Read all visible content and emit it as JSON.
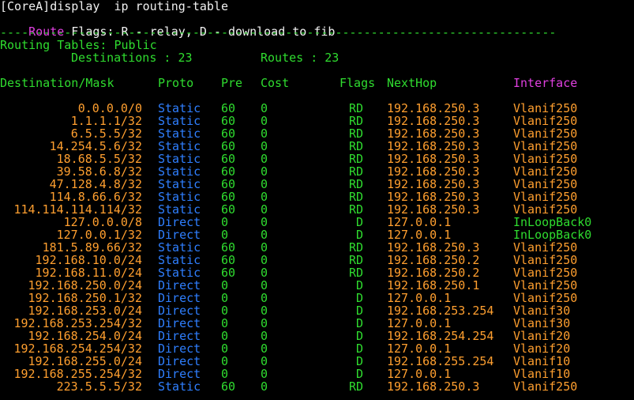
{
  "terminal": {
    "prompt_line": "[CoreA]display  ip routing-table",
    "flags_line": {
      "label": "Route",
      "text": " Flags: R - relay, D - download to fib"
    },
    "separator": "------------------------------------------------------------------------------",
    "tables_line": "Routing Tables: Public",
    "destinations_label": "Destinations : 23",
    "routes_label": "Routes : 23",
    "headers": {
      "destination": "Destination/Mask",
      "proto": "Proto",
      "pre": "Pre",
      "cost": "Cost",
      "flags": "Flags",
      "nexthop": "NextHop",
      "interface": "Interface"
    },
    "routes": [
      {
        "dest": "0.0.0.0/0",
        "proto": "Static",
        "pre": "60",
        "cost": "0",
        "flags": "RD",
        "nexthop": "192.168.250.3",
        "iface": "Vlanif250"
      },
      {
        "dest": "1.1.1.1/32",
        "proto": "Static",
        "pre": "60",
        "cost": "0",
        "flags": "RD",
        "nexthop": "192.168.250.3",
        "iface": "Vlanif250"
      },
      {
        "dest": "6.5.5.5/32",
        "proto": "Static",
        "pre": "60",
        "cost": "0",
        "flags": "RD",
        "nexthop": "192.168.250.3",
        "iface": "Vlanif250"
      },
      {
        "dest": "14.254.5.6/32",
        "proto": "Static",
        "pre": "60",
        "cost": "0",
        "flags": "RD",
        "nexthop": "192.168.250.3",
        "iface": "Vlanif250"
      },
      {
        "dest": "18.68.5.5/32",
        "proto": "Static",
        "pre": "60",
        "cost": "0",
        "flags": "RD",
        "nexthop": "192.168.250.3",
        "iface": "Vlanif250"
      },
      {
        "dest": "39.58.6.8/32",
        "proto": "Static",
        "pre": "60",
        "cost": "0",
        "flags": "RD",
        "nexthop": "192.168.250.3",
        "iface": "Vlanif250"
      },
      {
        "dest": "47.128.4.8/32",
        "proto": "Static",
        "pre": "60",
        "cost": "0",
        "flags": "RD",
        "nexthop": "192.168.250.3",
        "iface": "Vlanif250"
      },
      {
        "dest": "114.8.66.6/32",
        "proto": "Static",
        "pre": "60",
        "cost": "0",
        "flags": "RD",
        "nexthop": "192.168.250.3",
        "iface": "Vlanif250"
      },
      {
        "dest": "114.114.114.114/32",
        "proto": "Static",
        "pre": "60",
        "cost": "0",
        "flags": "RD",
        "nexthop": "192.168.250.3",
        "iface": "Vlanif250"
      },
      {
        "dest": "127.0.0.0/8",
        "proto": "Direct",
        "pre": "0",
        "cost": "0",
        "flags": "D",
        "nexthop": "127.0.0.1",
        "iface": "InLoopBack0"
      },
      {
        "dest": "127.0.0.1/32",
        "proto": "Direct",
        "pre": "0",
        "cost": "0",
        "flags": "D",
        "nexthop": "127.0.0.1",
        "iface": "InLoopBack0"
      },
      {
        "dest": "181.5.89.66/32",
        "proto": "Static",
        "pre": "60",
        "cost": "0",
        "flags": "RD",
        "nexthop": "192.168.250.3",
        "iface": "Vlanif250"
      },
      {
        "dest": "192.168.10.0/24",
        "proto": "Static",
        "pre": "60",
        "cost": "0",
        "flags": "RD",
        "nexthop": "192.168.250.2",
        "iface": "Vlanif250"
      },
      {
        "dest": "192.168.11.0/24",
        "proto": "Static",
        "pre": "60",
        "cost": "0",
        "flags": "RD",
        "nexthop": "192.168.250.2",
        "iface": "Vlanif250"
      },
      {
        "dest": "192.168.250.0/24",
        "proto": "Direct",
        "pre": "0",
        "cost": "0",
        "flags": "D",
        "nexthop": "192.168.250.1",
        "iface": "Vlanif250"
      },
      {
        "dest": "192.168.250.1/32",
        "proto": "Direct",
        "pre": "0",
        "cost": "0",
        "flags": "D",
        "nexthop": "127.0.0.1",
        "iface": "Vlanif250"
      },
      {
        "dest": "192.168.253.0/24",
        "proto": "Direct",
        "pre": "0",
        "cost": "0",
        "flags": "D",
        "nexthop": "192.168.253.254",
        "iface": "Vlanif30"
      },
      {
        "dest": "192.168.253.254/32",
        "proto": "Direct",
        "pre": "0",
        "cost": "0",
        "flags": "D",
        "nexthop": "127.0.0.1",
        "iface": "Vlanif30"
      },
      {
        "dest": "192.168.254.0/24",
        "proto": "Direct",
        "pre": "0",
        "cost": "0",
        "flags": "D",
        "nexthop": "192.168.254.254",
        "iface": "Vlanif20"
      },
      {
        "dest": "192.168.254.254/32",
        "proto": "Direct",
        "pre": "0",
        "cost": "0",
        "flags": "D",
        "nexthop": "127.0.0.1",
        "iface": "Vlanif20"
      },
      {
        "dest": "192.168.255.0/24",
        "proto": "Direct",
        "pre": "0",
        "cost": "0",
        "flags": "D",
        "nexthop": "192.168.255.254",
        "iface": "Vlanif10"
      },
      {
        "dest": "192.168.255.254/32",
        "proto": "Direct",
        "pre": "0",
        "cost": "0",
        "flags": "D",
        "nexthop": "127.0.0.1",
        "iface": "Vlanif10"
      },
      {
        "dest": "223.5.5.5/32",
        "proto": "Static",
        "pre": "60",
        "cost": "0",
        "flags": "RD",
        "nexthop": "192.168.250.3",
        "iface": "Vlanif250"
      }
    ],
    "colors": {
      "background": "#000000",
      "green": "#2fdc2f",
      "blue": "#2f7fff",
      "orange": "#ff9f2f",
      "magenta": "#e040e0",
      "white": "#f0f0f0"
    }
  }
}
